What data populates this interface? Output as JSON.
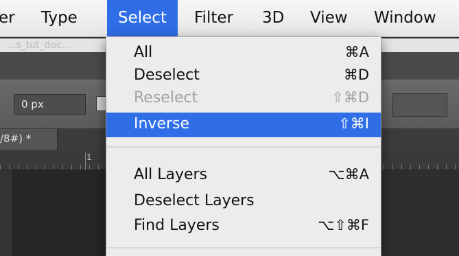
{
  "menubar": {
    "items": [
      "er",
      "Type",
      "Select",
      "Filter",
      "3D",
      "View",
      "Window"
    ],
    "active": "Select"
  },
  "document": {
    "faded_title": "...s_tut_doc...",
    "tab_label": "/8#) *",
    "ruler_label": "1"
  },
  "options_bar": {
    "feather_value": "0 px"
  },
  "select_menu": {
    "items": [
      {
        "label": "All",
        "shortcut": "⌘A",
        "state": "enabled"
      },
      {
        "label": "Deselect",
        "shortcut": "⌘D",
        "state": "enabled"
      },
      {
        "label": "Reselect",
        "shortcut": "⇧⌘D",
        "state": "disabled"
      },
      {
        "label": "Inverse",
        "shortcut": "⇧⌘I",
        "state": "highlighted"
      },
      {
        "label": "All Layers",
        "shortcut": "⌥⌘A",
        "state": "enabled"
      },
      {
        "label": "Deselect Layers",
        "shortcut": "",
        "state": "enabled"
      },
      {
        "label": "Find Layers",
        "shortcut": "⌥⇧⌘F",
        "state": "enabled"
      }
    ]
  },
  "colors": {
    "highlight": "#2f6ee6",
    "menu_bg": "#ececec",
    "disabled_text": "#a3a3a3"
  }
}
